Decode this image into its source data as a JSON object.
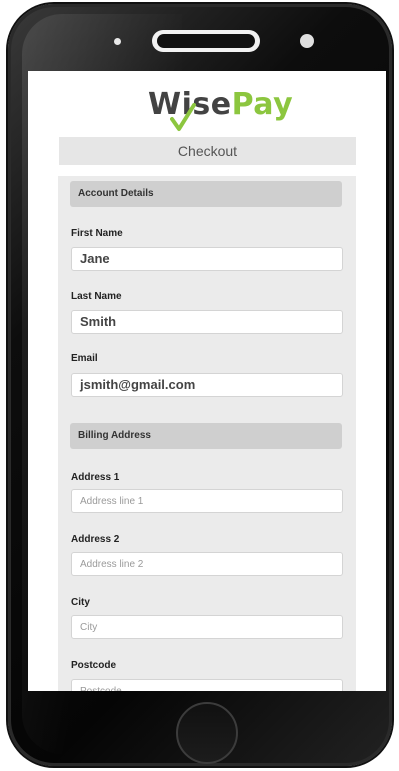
{
  "brand": {
    "logo_part1": "Wise",
    "logo_part2": "Pay"
  },
  "checkout": {
    "title": "Checkout"
  },
  "account": {
    "heading": "Account Details",
    "first_name": {
      "label": "First Name",
      "value": "Jane"
    },
    "last_name": {
      "label": "Last Name",
      "value": "Smith"
    },
    "email": {
      "label": "Email",
      "value": "jsmith@gmail.com"
    }
  },
  "billing": {
    "heading": "Billing Address",
    "address1": {
      "label": "Address 1",
      "placeholder": "Address line 1"
    },
    "address2": {
      "label": "Address 2",
      "placeholder": "Address line 2"
    },
    "city": {
      "label": "City",
      "placeholder": "City"
    },
    "postcode": {
      "label": "Postcode",
      "placeholder": "Postcode"
    }
  },
  "colors": {
    "brand_green": "#8cc63f",
    "brand_gray": "#434343",
    "panel_bg": "#ebebeb",
    "section_head_bg": "#cfcfcf"
  }
}
